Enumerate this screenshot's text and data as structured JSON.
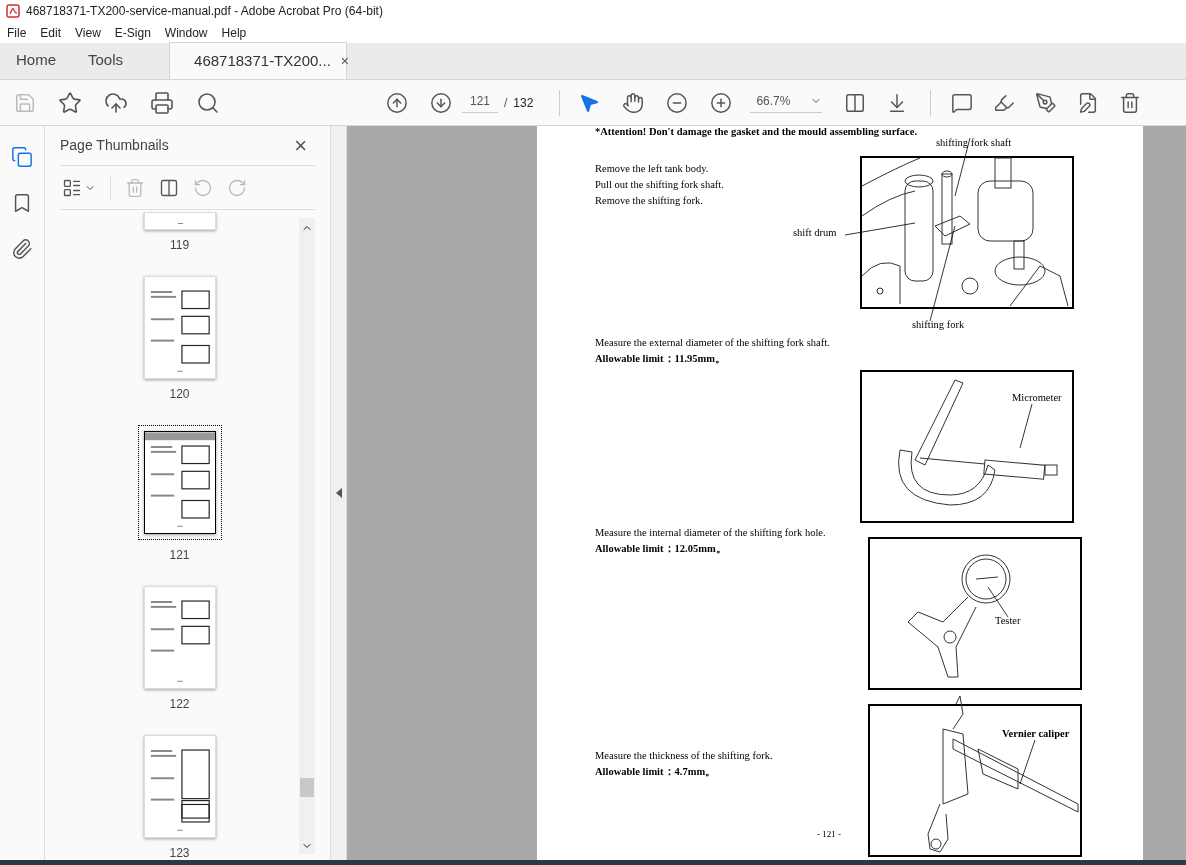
{
  "window": {
    "title": "468718371-TX200-service-manual.pdf - Adobe Acrobat Pro (64-bit)"
  },
  "menu": [
    "File",
    "Edit",
    "View",
    "E-Sign",
    "Window",
    "Help"
  ],
  "tabs": [
    {
      "label": "Home",
      "selected": false,
      "kind": "app"
    },
    {
      "label": "Tools",
      "selected": false,
      "kind": "app"
    },
    {
      "label": "468718371-TX200...",
      "selected": true,
      "kind": "document",
      "close": "×"
    }
  ],
  "toolbar": {
    "page_current": "121",
    "page_separator": "/",
    "page_total": "132",
    "zoom": "66.7%"
  },
  "side_rail": [
    {
      "kind": "pages",
      "selected": true
    },
    {
      "kind": "bookmarks",
      "selected": false
    },
    {
      "kind": "attachments",
      "selected": false
    }
  ],
  "sidebar": {
    "title": "Page Thumbnails",
    "close": "×",
    "thumbnails": [
      {
        "label": "119",
        "selected": false,
        "partial": true
      },
      {
        "label": "120",
        "selected": false
      },
      {
        "label": "121",
        "selected": true
      },
      {
        "label": "122",
        "selected": false
      },
      {
        "label": "123",
        "selected": false
      }
    ]
  },
  "document": {
    "attention": "*Attention!   Don't damage the gasket and the mould assembling surface.",
    "sections": [
      {
        "lines": [
          {
            "text": "Remove the left tank body.",
            "kind": "step"
          },
          {
            "text": "Pull out the shifting fork shaft.",
            "kind": "step"
          },
          {
            "text": "Remove the shifting fork.",
            "kind": "step"
          }
        ]
      },
      {
        "lines": [
          {
            "text": "Measure the external diameter of the shifting fork shaft.",
            "kind": "step"
          },
          {
            "text": "Allowable limit：11.95mm。",
            "kind": "limit"
          }
        ]
      },
      {
        "lines": [
          {
            "text": "Measure the internal diameter of the shifting fork hole.",
            "kind": "step"
          },
          {
            "text": "Allowable limit：12.05mm。",
            "kind": "limit"
          }
        ]
      },
      {
        "lines": [
          {
            "text": "Measure the thickness of the shifting fork.",
            "kind": "step"
          },
          {
            "text": "Allowable limit：4.7mm。",
            "kind": "limit"
          }
        ]
      }
    ],
    "figures": [
      {
        "kind": "engine",
        "labels": [
          "shifting fork shaft",
          "shift drum",
          "shifting fork"
        ]
      },
      {
        "kind": "micrometer",
        "labels": [
          "Micrometer"
        ]
      },
      {
        "kind": "dial",
        "labels": [
          "Tester"
        ]
      },
      {
        "kind": "caliper",
        "labels": [
          "Vernier caliper"
        ]
      }
    ],
    "page_number": "- 121 -"
  }
}
